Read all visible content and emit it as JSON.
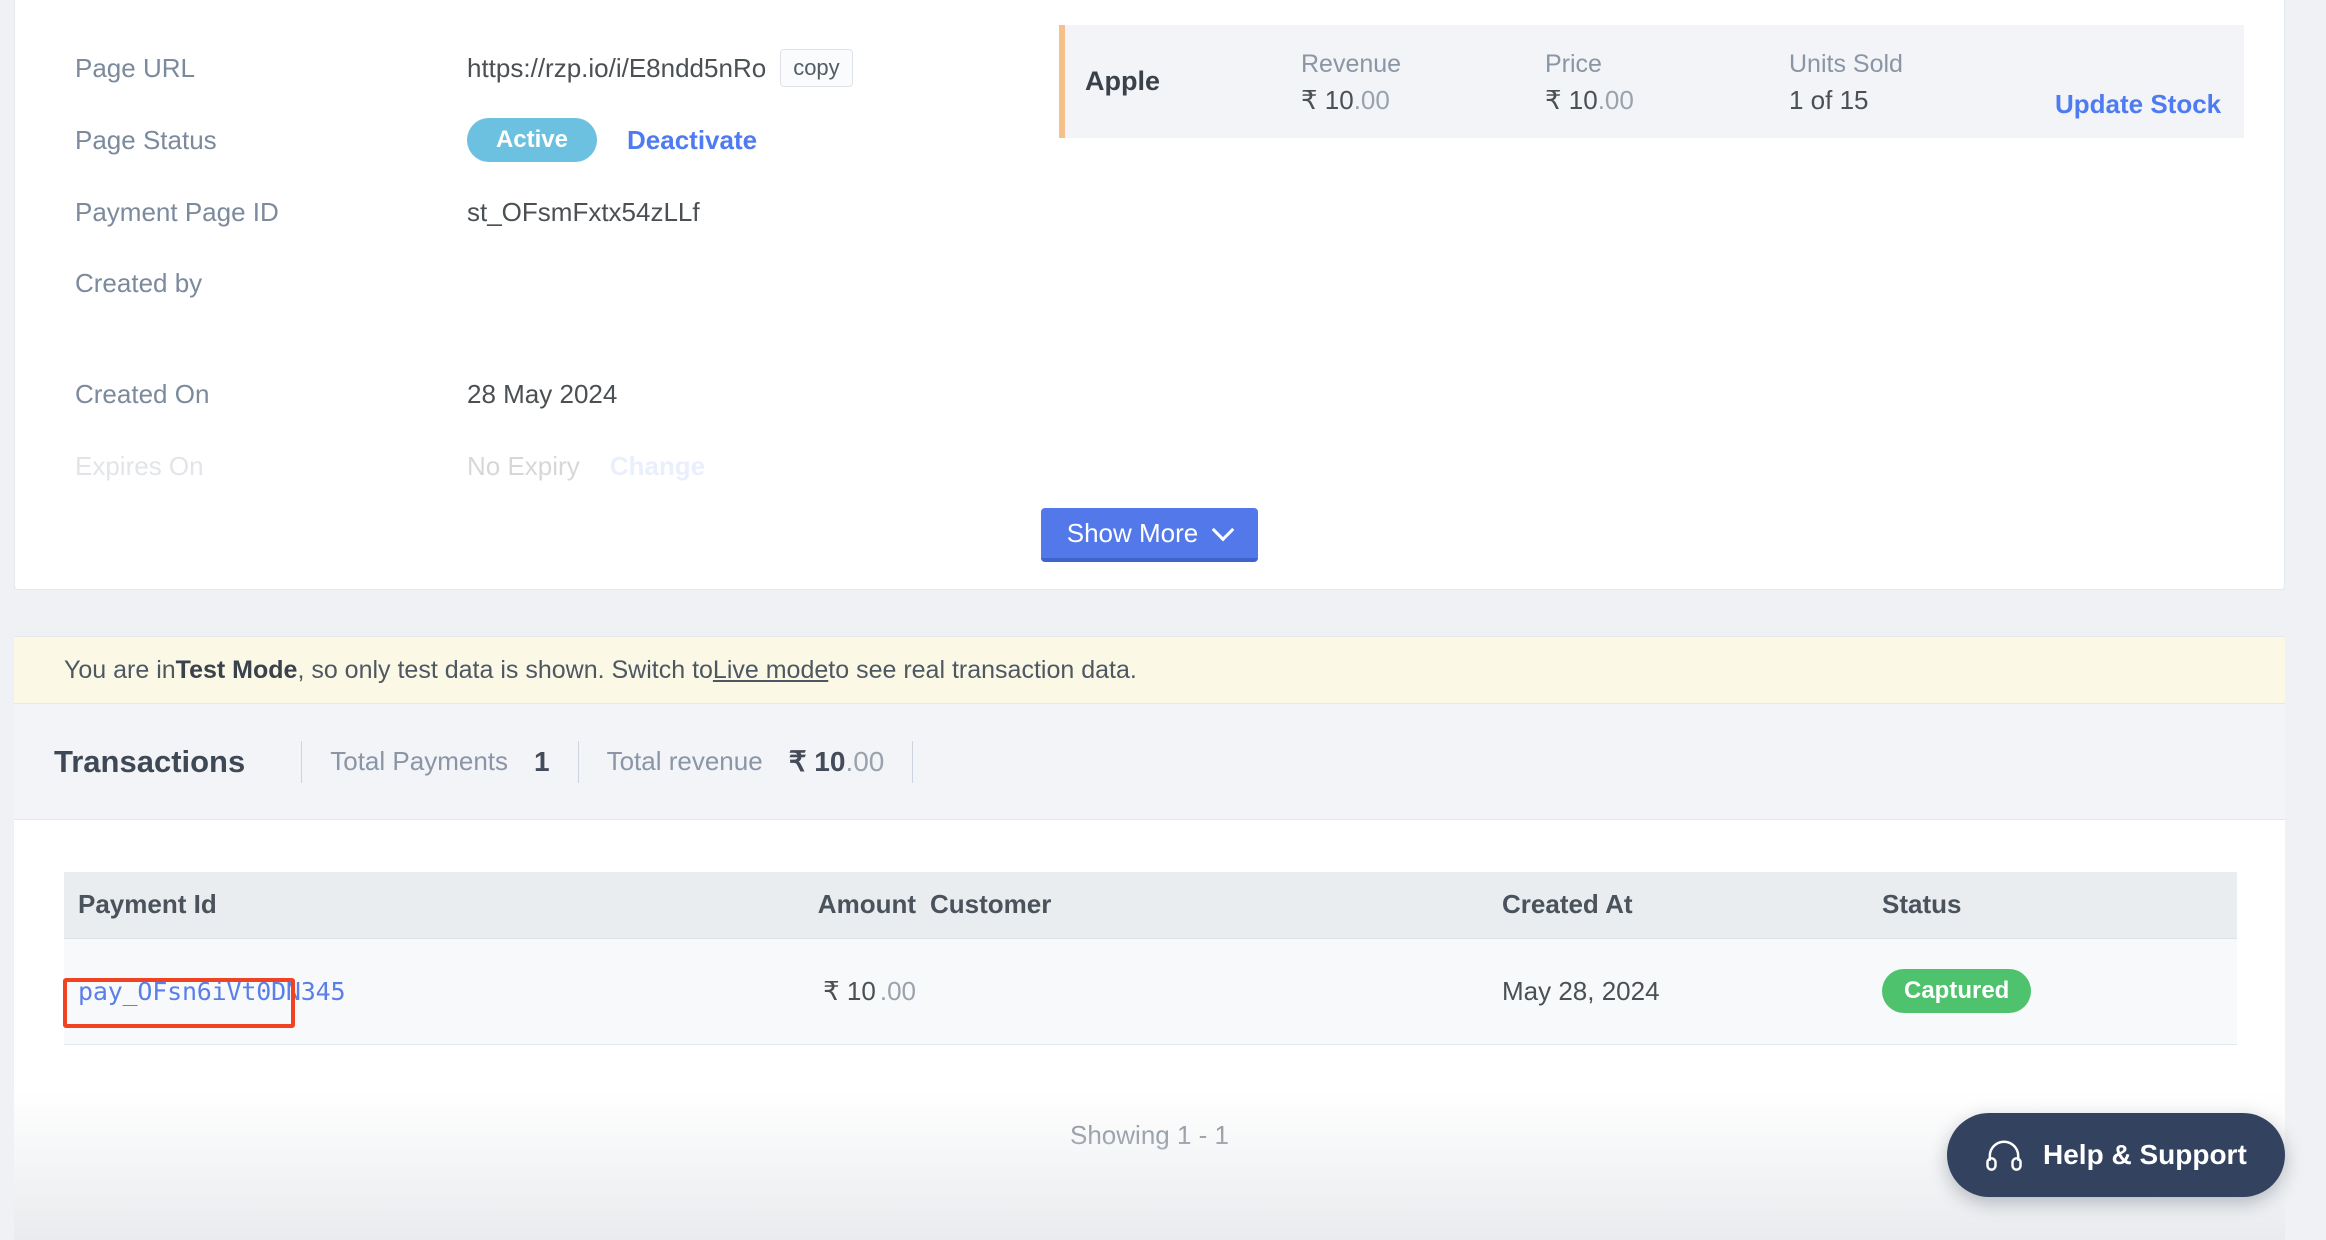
{
  "details": {
    "rows": [
      {
        "label": "Page URL",
        "value": "https://rzp.io/i/E8ndd5nRo",
        "action": "copy"
      },
      {
        "label": "Page Status",
        "value": "Active",
        "action": "Deactivate"
      },
      {
        "label": "Payment Page ID",
        "value": "st_OFsmFxtx54zLLf"
      },
      {
        "label": "Created by",
        "value": ""
      },
      {
        "label": "Created On",
        "value": "28 May 2024"
      },
      {
        "label": "Expires On",
        "value": "No Expiry",
        "action": "Change"
      }
    ],
    "show_more_label": "Show More"
  },
  "product": {
    "name": "Apple",
    "metrics": [
      {
        "label": "Revenue",
        "int": "₹ 10",
        "dec": ".00"
      },
      {
        "label": "Price",
        "int": "₹ 10",
        "dec": ".00"
      },
      {
        "label": "Units Sold",
        "int": "1 of 15",
        "dec": ""
      }
    ],
    "update_stock_label": "Update Stock"
  },
  "test_banner": {
    "prefix": "You are in ",
    "mode": "Test Mode",
    "middle": ", so only test data is shown. Switch to ",
    "link": "Live mode",
    "suffix": " to see real transaction data."
  },
  "transactions": {
    "title": "Transactions",
    "total_payments_label": "Total Payments",
    "total_payments_value": "1",
    "total_revenue_label": "Total revenue",
    "total_revenue_int": "₹ 10",
    "total_revenue_dec": ".00",
    "columns": [
      "Payment Id",
      "Amount",
      "Customer",
      "Created At",
      "Status"
    ],
    "rows": [
      {
        "payment_id": "pay_OFsn6iVt0DN345",
        "amount_int": "₹ 10",
        "amount_dec": ".00",
        "customer": "",
        "created_at": "May 28, 2024",
        "status": "Captured"
      }
    ],
    "showing": "Showing 1 - 1"
  },
  "help": {
    "label": "Help & Support",
    "icon": "headset-icon"
  },
  "colors": {
    "accent_blue": "#4f7bf2",
    "button_blue": "#5278ea",
    "active_badge": "#6cc0e0",
    "captured_badge": "#4fc26d",
    "highlight_red": "#ef4323",
    "banner_yellow": "#fbf8e5",
    "page_bg": "#eff1f4",
    "product_accent": "#f5c08a",
    "help_bg": "#33425e"
  }
}
